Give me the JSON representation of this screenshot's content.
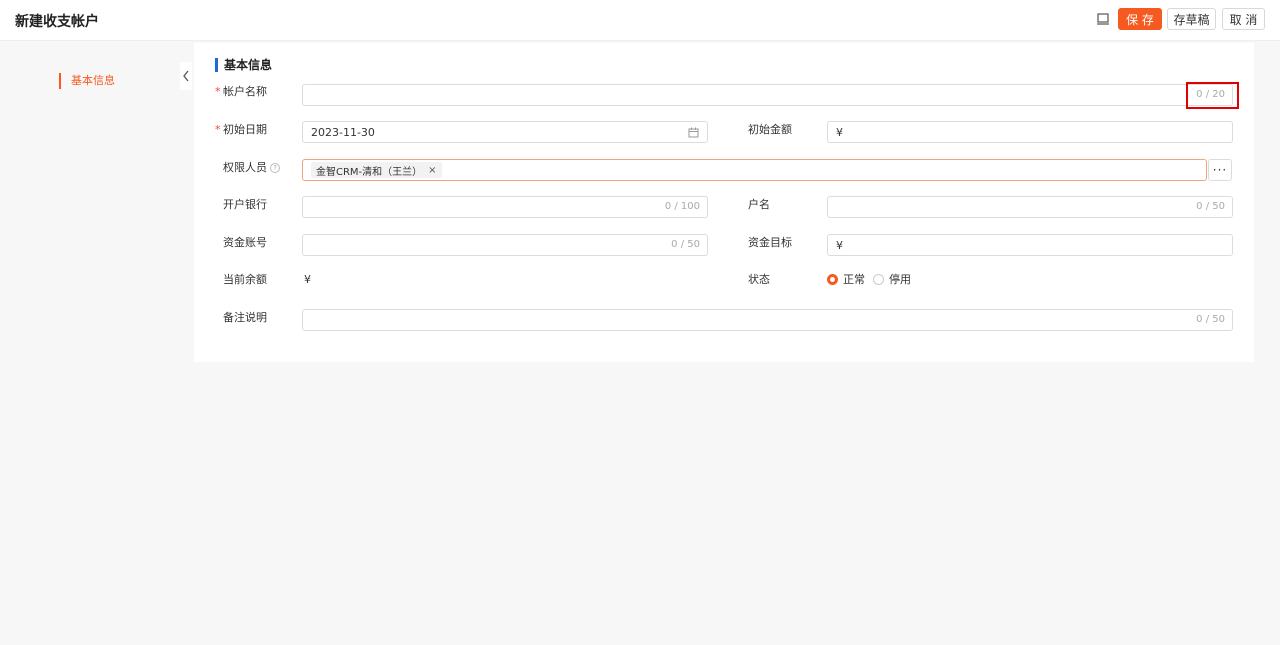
{
  "header": {
    "title": "新建收支帐户",
    "save_label": "保 存",
    "draft_label": "存草稿",
    "cancel_label": "取 消"
  },
  "sidebar": {
    "items": [
      {
        "label": "基本信息",
        "active": true
      }
    ]
  },
  "section": {
    "title": "基本信息"
  },
  "form": {
    "account_name": {
      "label": "帐户名称",
      "required": true,
      "value": "",
      "counter": "0 / 20"
    },
    "start_date": {
      "label": "初始日期",
      "required": true,
      "value": "2023-11-30"
    },
    "initial_amount": {
      "label": "初始金额",
      "prefix": "¥",
      "value": ""
    },
    "permission_users": {
      "label": "权限人员",
      "help": "?",
      "tags": [
        "金智CRM-清和（王兰）"
      ],
      "tag_remove": "×",
      "more": "···"
    },
    "bank": {
      "label": "开户银行",
      "value": "",
      "counter": "0 / 100"
    },
    "holder": {
      "label": "户名",
      "value": "",
      "counter": "0 / 50"
    },
    "account_no": {
      "label": "资金账号",
      "value": "",
      "counter": "0 / 50"
    },
    "target": {
      "label": "资金目标",
      "prefix": "¥",
      "value": ""
    },
    "balance": {
      "label": "当前余额",
      "value": "¥"
    },
    "status": {
      "label": "状态",
      "options": [
        "正常",
        "停用"
      ],
      "selected": "正常"
    },
    "remark": {
      "label": "备注说明",
      "value": "",
      "counter": "0 / 50"
    }
  },
  "colors": {
    "accent": "#f75a21",
    "section_bar": "#1f6bd6",
    "highlight": "#e00000"
  }
}
